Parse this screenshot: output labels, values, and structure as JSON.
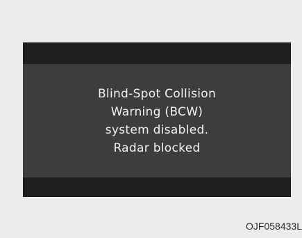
{
  "display": {
    "message_lines": [
      "Blind-Spot Collision",
      "Warning (BCW)",
      "system disabled.",
      "Radar blocked"
    ]
  },
  "figure_code": "OJF058433L"
}
